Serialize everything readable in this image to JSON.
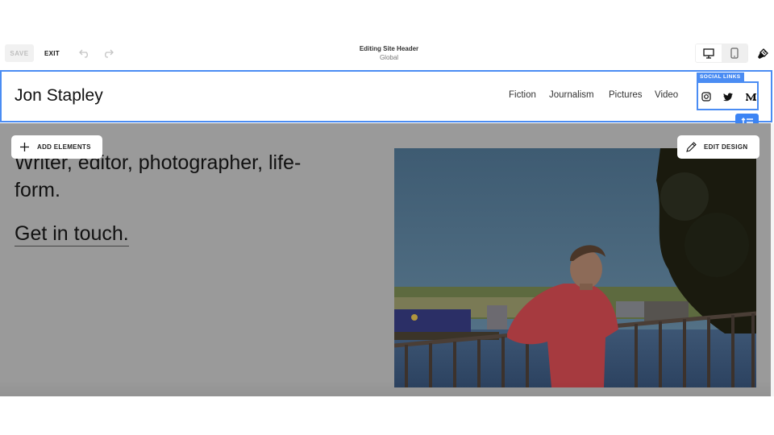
{
  "toolbar": {
    "save_label": "SAVE",
    "exit_label": "EXIT",
    "title": "Editing Site Header",
    "subtitle": "Global",
    "device_selected": "desktop"
  },
  "header": {
    "site_title": "Jon Stapley",
    "nav": [
      "Fiction",
      "Journalism",
      "Pictures",
      "Video"
    ],
    "social_label": "SOCIAL LINKS",
    "social_icons": [
      "instagram-icon",
      "twitter-icon",
      "medium-icon"
    ],
    "accent_color": "#4a8cf3"
  },
  "content": {
    "tagline": "Writer, editor, photographer, life-form.",
    "cta": "Get in touch.",
    "add_elements_label": "ADD ELEMENTS",
    "edit_design_label": "EDIT DESIGN",
    "photo_alt": "Man in red sweater leaning on railing by canal with boats"
  }
}
